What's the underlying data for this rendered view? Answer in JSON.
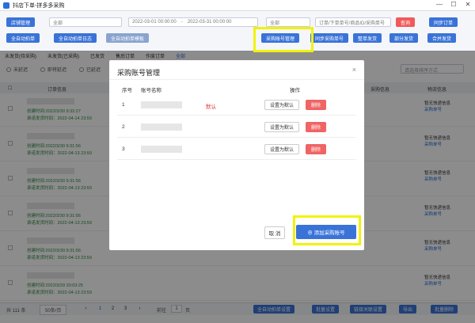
{
  "window": {
    "title": "抖店下单-拼多多采购",
    "minimize": "—",
    "maximize": "☐",
    "close": "✕"
  },
  "toolbar": {
    "store_manage": "店铺管理",
    "all_stores": "全部",
    "date_start": "2022-03-01 00:00:00",
    "date_end": "2022-03-31 00:00:00",
    "order_type": "全部",
    "search_placeholder": "订单/下单单号/商品ID/采购单号",
    "search_button": "查询",
    "sync_button": "同步订单",
    "auto_sync": "全自动拍单",
    "auto_sync_log": "全自动拍单日志",
    "auto_template": "全自动拍单模板",
    "purchase_account_manage": "采购账号管理",
    "sync_purchase_no": "同步采购单号",
    "pdd_ship": "整单发货",
    "partial_ship": "部分发货",
    "merge_ship": "合并发货"
  },
  "tabs": [
    "未发货(待采购)",
    "未发货(已采购)",
    "已发货",
    "售后订单",
    "作废订单",
    "全部"
  ],
  "filters": [
    "未延迟",
    "即将延迟",
    "已延迟"
  ],
  "filter_placeholder": "请选择排序方式",
  "table": {
    "headers": [
      "订单信息",
      "采购信息",
      "物流信息"
    ]
  },
  "rows": [
    {
      "created": "创建时间:2022/3/30 9:32:27",
      "promise": "承诺发货时间：2022-04-14 23:59",
      "logistics": "暂无快递信息",
      "fill": "采购单号"
    },
    {
      "created": "创建时间:2022/3/30 9:31:56",
      "promise": "承诺发货时间：2022-04-13 23:59",
      "logistics": "暂无快递信息",
      "fill": "采购单号"
    },
    {
      "created": "创建时间:2022/3/30 9:31:56",
      "promise": "承诺发货时间：2022-04-13 23:59",
      "logistics": "暂无快递信息",
      "fill": "采购单号"
    },
    {
      "created": "创建时间:2022/3/30 9:31:56",
      "promise": "承诺发货时间：2022-04-13 23:59",
      "logistics": "暂无快递信息",
      "fill": "采购单号"
    },
    {
      "created": "创建时间:2022/3/30 9:31:56",
      "promise": "承诺发货时间：2022-04-13 23:59",
      "logistics": "暂无快递信息",
      "fill": "采购单号"
    },
    {
      "created": "创建时间:2022/3/29 20:03:25",
      "promise": "承诺发货时间：2022-04-13 23:59",
      "logistics": "暂无快递信息",
      "fill": "采购单号"
    }
  ],
  "footer": {
    "total": "共 111 条",
    "page_size": "50条/页",
    "pages": [
      "1",
      "2",
      "3"
    ],
    "goto": "前往",
    "goto_page": "1",
    "goto_suffix": "页",
    "auto_settings": "全自动拍单设置",
    "batch_settings": "批量设置",
    "link_reset": "链接关联设置",
    "export": "导出",
    "batch_delete": "批量删除"
  },
  "modal": {
    "title": "采购账号管理",
    "close": "×",
    "col_index": "序号",
    "col_account": "账号名称",
    "col_action": "操作",
    "accounts": [
      {
        "index": "1",
        "default_label": "默认",
        "set_default": "设置为默认",
        "delete": "删除"
      },
      {
        "index": "2",
        "default_label": "",
        "set_default": "设置为默认",
        "delete": "删除"
      },
      {
        "index": "3",
        "default_label": "",
        "set_default": "设置为默认",
        "delete": "删除"
      }
    ],
    "cancel": "取 消",
    "add_account": "⊕ 添加采购账号"
  },
  "colors": {
    "primary": "#3a73d8",
    "danger": "#f06464",
    "highlight": "#f2f20a"
  }
}
